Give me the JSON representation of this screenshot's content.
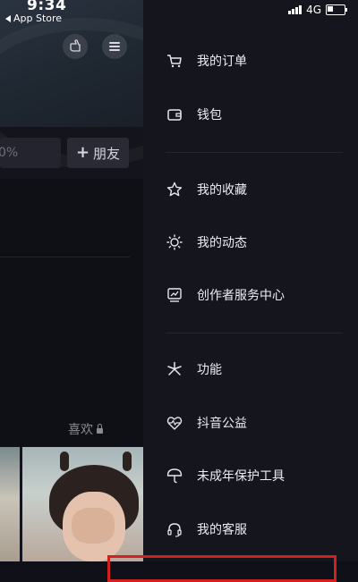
{
  "status_bar": {
    "time": "9:34",
    "back_app": "App Store",
    "network": "4G"
  },
  "profile_bg": {
    "percent_text": "0%",
    "add_friend_label": "朋友",
    "likes_label": "喜欢"
  },
  "drawer": {
    "groups": [
      [
        {
          "label": "我的订单",
          "icon": "cart-icon"
        },
        {
          "label": "钱包",
          "icon": "wallet-icon"
        }
      ],
      [
        {
          "label": "我的收藏",
          "icon": "star-icon"
        },
        {
          "label": "我的动态",
          "icon": "sun-icon"
        },
        {
          "label": "创作者服务中心",
          "icon": "chart-monitor-icon"
        }
      ],
      [
        {
          "label": "功能",
          "icon": "asterisk-icon"
        },
        {
          "label": "抖音公益",
          "icon": "heart-pulse-icon"
        },
        {
          "label": "未成年保护工具",
          "icon": "umbrella-icon"
        },
        {
          "label": "我的客服",
          "icon": "headset-icon"
        }
      ]
    ]
  },
  "colors": {
    "highlight": "#d21f1f",
    "drawer_bg": "#15151d"
  }
}
